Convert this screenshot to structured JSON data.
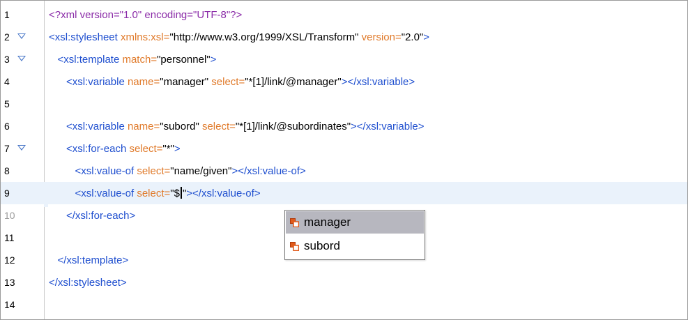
{
  "editor": {
    "lines": [
      {
        "num": "1",
        "fold": false,
        "segments": [
          {
            "cls": "pi",
            "text": "<?xml version=\"1.0\" encoding=\"UTF-8\"?>"
          }
        ]
      },
      {
        "num": "2",
        "fold": true,
        "segments": [
          {
            "cls": "tag",
            "text": "<xsl:stylesheet "
          },
          {
            "cls": "attr",
            "text": "xmlns:xsl="
          },
          {
            "cls": "val",
            "text": "\"http://www.w3.org/1999/XSL/Transform\""
          },
          {
            "cls": "attr",
            "text": " version="
          },
          {
            "cls": "val",
            "text": "\"2.0\""
          },
          {
            "cls": "tag",
            "text": ">"
          }
        ]
      },
      {
        "num": "3",
        "fold": true,
        "segments": [
          {
            "cls": "tag",
            "text": "   <xsl:template "
          },
          {
            "cls": "attr",
            "text": "match="
          },
          {
            "cls": "val",
            "text": "\"personnel\""
          },
          {
            "cls": "tag",
            "text": ">"
          }
        ]
      },
      {
        "num": "4",
        "fold": false,
        "segments": [
          {
            "cls": "tag",
            "text": "      <xsl:variable "
          },
          {
            "cls": "attr",
            "text": "name="
          },
          {
            "cls": "val",
            "text": "\"manager\""
          },
          {
            "cls": "attr",
            "text": " select="
          },
          {
            "cls": "val",
            "text": "\"*[1]/link/@manager\""
          },
          {
            "cls": "tag",
            "text": "></xsl:variable>"
          }
        ]
      },
      {
        "num": "5",
        "fold": false,
        "segments": []
      },
      {
        "num": "6",
        "fold": false,
        "segments": [
          {
            "cls": "tag",
            "text": "      <xsl:variable "
          },
          {
            "cls": "attr",
            "text": "name="
          },
          {
            "cls": "val",
            "text": "\"subord\""
          },
          {
            "cls": "attr",
            "text": " select="
          },
          {
            "cls": "val",
            "text": "\"*[1]/link/@subordinates\""
          },
          {
            "cls": "tag",
            "text": "></xsl:variable>"
          }
        ]
      },
      {
        "num": "7",
        "fold": true,
        "segments": [
          {
            "cls": "tag",
            "text": "      <xsl:for-each "
          },
          {
            "cls": "attr",
            "text": "select="
          },
          {
            "cls": "val",
            "text": "\"*\""
          },
          {
            "cls": "tag",
            "text": ">"
          }
        ]
      },
      {
        "num": "8",
        "fold": false,
        "segments": [
          {
            "cls": "tag",
            "text": "         <xsl:value-of "
          },
          {
            "cls": "attr",
            "text": "select="
          },
          {
            "cls": "val",
            "text": "\"name/given\""
          },
          {
            "cls": "tag",
            "text": "></xsl:value-of>"
          }
        ]
      },
      {
        "num": "9",
        "fold": false,
        "current": true,
        "segments": [
          {
            "cls": "tag",
            "text": "         <xsl:value-of "
          },
          {
            "cls": "attr",
            "text": "select="
          },
          {
            "cls": "val",
            "text": "\"$"
          },
          {
            "cls": "caret",
            "text": ""
          },
          {
            "cls": "val",
            "text": "\""
          },
          {
            "cls": "tag",
            "text": "></xsl:value-of>"
          }
        ]
      },
      {
        "num": "10",
        "fold": false,
        "dim": true,
        "segments": [
          {
            "cls": "tag",
            "text": "      </xsl:for-each>"
          }
        ]
      },
      {
        "num": "11",
        "fold": false,
        "segments": []
      },
      {
        "num": "12",
        "fold": false,
        "segments": [
          {
            "cls": "tag",
            "text": "   </xsl:template>"
          }
        ]
      },
      {
        "num": "13",
        "fold": false,
        "segments": [
          {
            "cls": "tag",
            "text": "</xsl:stylesheet>"
          }
        ]
      },
      {
        "num": "14",
        "fold": false,
        "segments": []
      }
    ]
  },
  "autocomplete": {
    "items": [
      {
        "label": "manager",
        "icon": "variable-icon",
        "selected": true
      },
      {
        "label": "subord",
        "icon": "variable-icon",
        "selected": false
      }
    ],
    "icon_color": "#e05a1a"
  }
}
